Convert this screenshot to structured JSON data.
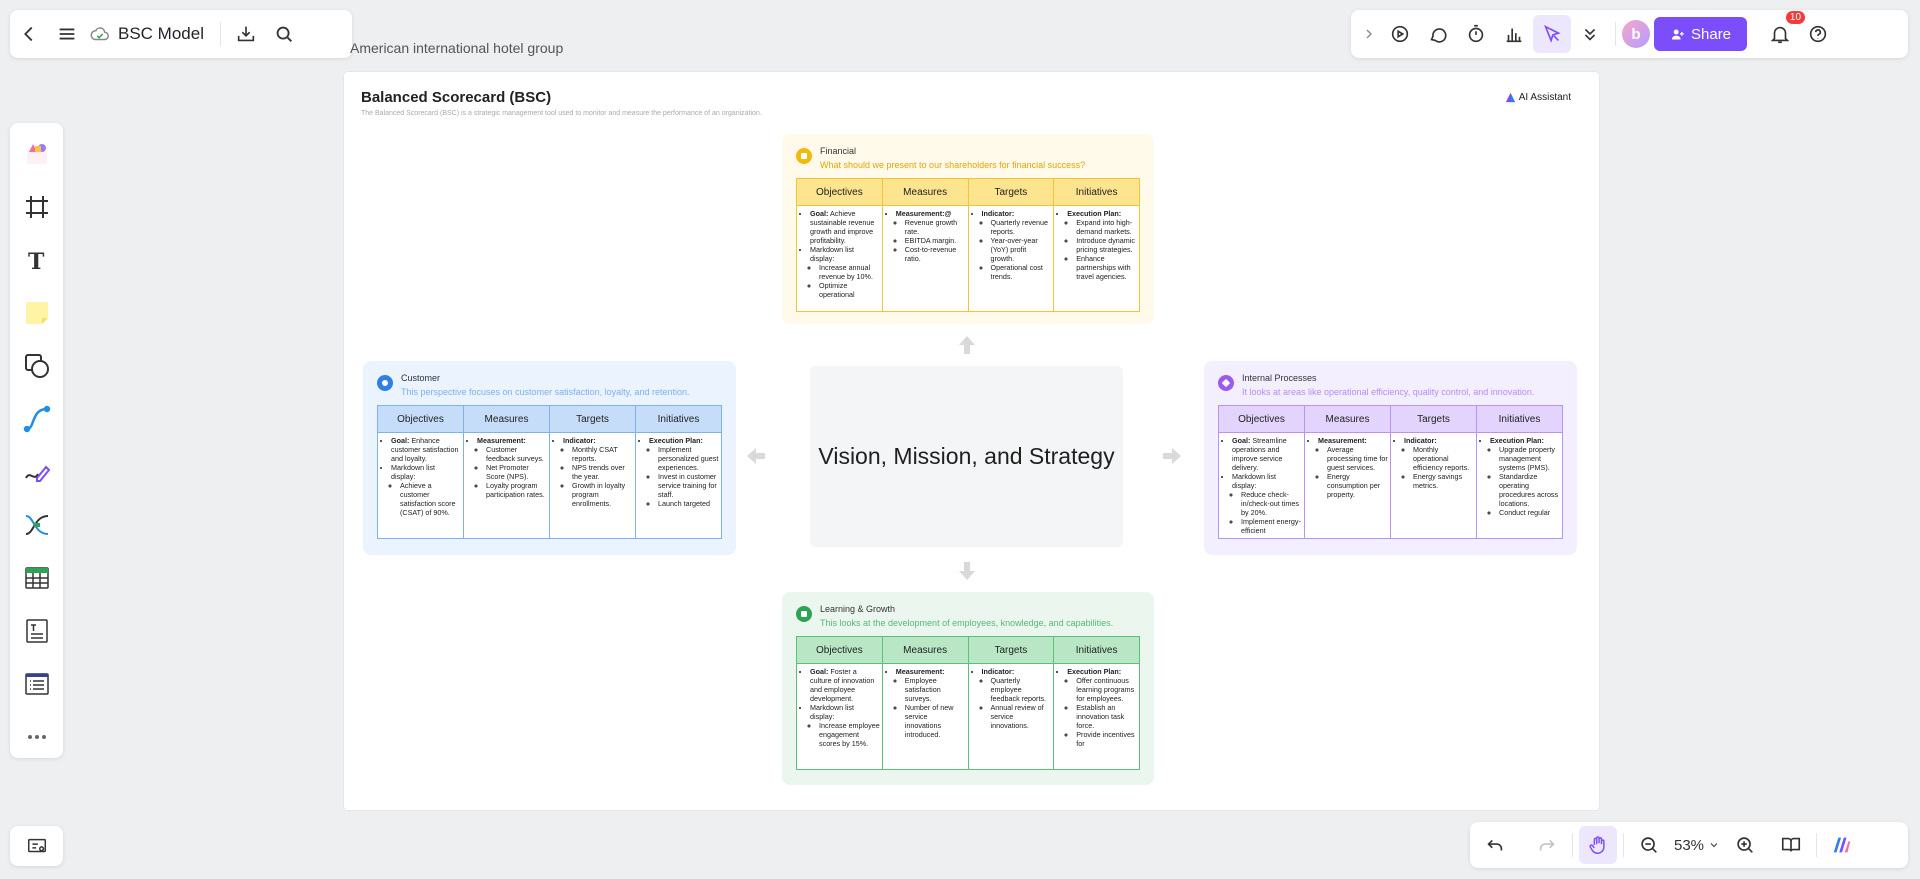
{
  "header": {
    "doc_title": "BSC Model",
    "breadcrumb": "American international hotel group"
  },
  "toolbar_right": {
    "avatar_letter": "b",
    "share_label": "Share",
    "notification_count": "10"
  },
  "zoom": "53%",
  "board": {
    "title": "Balanced Scorecard (BSC)",
    "subtitle": "The Balanced Scorecard (BSC) is a strategic management tool used to monitor and measure the performance of an organization.",
    "ai_label": "AI Assistant",
    "center": "Vision, Mission, and Strategy",
    "col_headers": [
      "Objectives",
      "Measures",
      "Targets",
      "Initiatives"
    ],
    "financial": {
      "name": "Financial",
      "desc": "What should we present to our shareholders for financial success?",
      "color": "#f2b90e"
    },
    "customer": {
      "name": "Customer",
      "desc": "This perspective focuses on customer satisfaction, loyalty, and retention.",
      "color": "#2f7fe6"
    },
    "internal": {
      "name": "Internal Processes",
      "desc": "It looks at areas like operational efficiency, quality control, and innovation.",
      "color": "#9a5cf0"
    },
    "learning": {
      "name": "Learning & Growth",
      "desc": "This looks at the development of employees, knowledge, and capabilities.",
      "color": "#2fa355"
    }
  }
}
